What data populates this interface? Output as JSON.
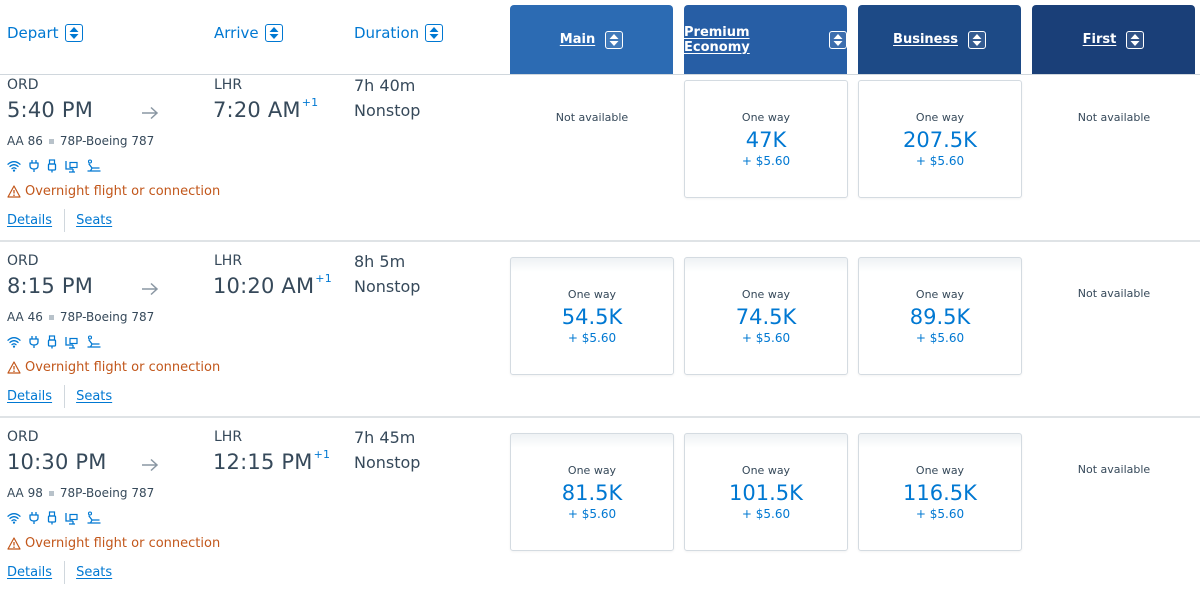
{
  "columns": {
    "depart": "Depart",
    "arrive": "Arrive",
    "duration": "Duration"
  },
  "cabins": [
    {
      "label": "Main",
      "color": "#2c6bb3"
    },
    {
      "label": "Premium Economy",
      "color": "#275ea5"
    },
    {
      "label": "Business",
      "color": "#1d4a86"
    },
    {
      "label": "First",
      "color": "#1a3f78"
    }
  ],
  "flights": [
    {
      "origin": "ORD",
      "depart_time": "5:40 PM",
      "destination": "LHR",
      "arrive_time": "7:20 AM",
      "day_offset": "+1",
      "duration": "7h 40m",
      "stops": "Nonstop",
      "flight_number": "AA 86",
      "aircraft": "78P-Boeing 787",
      "warning": "Overnight flight or connection",
      "details_label": "Details",
      "seats_label": "Seats",
      "fares": [
        {
          "available": false,
          "text": "Not available"
        },
        {
          "available": true,
          "type": "One way",
          "miles": "47K",
          "tax": "+ $5.60"
        },
        {
          "available": true,
          "type": "One way",
          "miles": "207.5K",
          "tax": "+ $5.60"
        },
        {
          "available": false,
          "text": "Not available"
        }
      ]
    },
    {
      "origin": "ORD",
      "depart_time": "8:15 PM",
      "destination": "LHR",
      "arrive_time": "10:20 AM",
      "day_offset": "+1",
      "duration": "8h 5m",
      "stops": "Nonstop",
      "flight_number": "AA 46",
      "aircraft": "78P-Boeing 787",
      "warning": "Overnight flight or connection",
      "details_label": "Details",
      "seats_label": "Seats",
      "fares": [
        {
          "available": true,
          "type": "One way",
          "miles": "54.5K",
          "tax": "+ $5.60"
        },
        {
          "available": true,
          "type": "One way",
          "miles": "74.5K",
          "tax": "+ $5.60"
        },
        {
          "available": true,
          "type": "One way",
          "miles": "89.5K",
          "tax": "+ $5.60"
        },
        {
          "available": false,
          "text": "Not available"
        }
      ]
    },
    {
      "origin": "ORD",
      "depart_time": "10:30 PM",
      "destination": "LHR",
      "arrive_time": "12:15 PM",
      "day_offset": "+1",
      "duration": "7h 45m",
      "stops": "Nonstop",
      "flight_number": "AA 98",
      "aircraft": "78P-Boeing 787",
      "warning": "Overnight flight or connection",
      "details_label": "Details",
      "seats_label": "Seats",
      "fares": [
        {
          "available": true,
          "type": "One way",
          "miles": "81.5K",
          "tax": "+ $5.60"
        },
        {
          "available": true,
          "type": "One way",
          "miles": "101.5K",
          "tax": "+ $5.60"
        },
        {
          "available": true,
          "type": "One way",
          "miles": "116.5K",
          "tax": "+ $5.60"
        },
        {
          "available": false,
          "text": "Not available"
        }
      ]
    }
  ],
  "amenity_icons": [
    "wifi-icon",
    "power-outlet-icon",
    "usb-icon",
    "seatback-entertainment-icon",
    "lie-flat-seat-icon"
  ],
  "colors": {
    "link": "#0078d2",
    "warning": "#c2571b",
    "text": "#36495a"
  }
}
